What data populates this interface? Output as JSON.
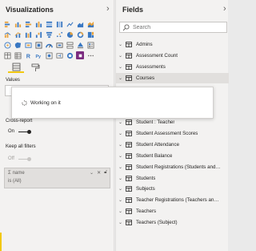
{
  "visualizations": {
    "title": "Visualizations",
    "values_label": "Values",
    "cross_report_label": "Cross-report",
    "cross_report_state": "On",
    "keep_filters_label": "Keep all filters",
    "keep_filters_state": "Off",
    "filter": {
      "name": "name",
      "condition": "is (All)"
    }
  },
  "fields": {
    "title": "Fields",
    "search_placeholder": "Search",
    "items": [
      {
        "label": "Admins",
        "selected": false
      },
      {
        "label": "Assessment Count",
        "selected": false
      },
      {
        "label": "Assessments",
        "selected": false
      },
      {
        "label": "Courses",
        "selected": true
      },
      {
        "label": "",
        "selected": false
      },
      {
        "label": "",
        "selected": false
      },
      {
        "label": "",
        "selected": false
      },
      {
        "label": "Student : Teacher",
        "selected": false
      },
      {
        "label": "Student Assessment Scores",
        "selected": false
      },
      {
        "label": "Student Attendance",
        "selected": false
      },
      {
        "label": "Student Balance",
        "selected": false
      },
      {
        "label": "Student Registrations (Students and ...",
        "selected": false
      },
      {
        "label": "Students",
        "selected": false
      },
      {
        "label": "Subjects",
        "selected": false
      },
      {
        "label": "Teacher Registrations (Teachers and ...",
        "selected": false
      },
      {
        "label": "Teachers",
        "selected": false
      },
      {
        "label": "Teachers (Subject)",
        "selected": false
      }
    ]
  },
  "dialog": {
    "text": "Working on it"
  },
  "colors": {
    "accent": "#f2c811",
    "pane_bg": "#f3f2f1",
    "selected_bg": "#e1dfdd"
  }
}
